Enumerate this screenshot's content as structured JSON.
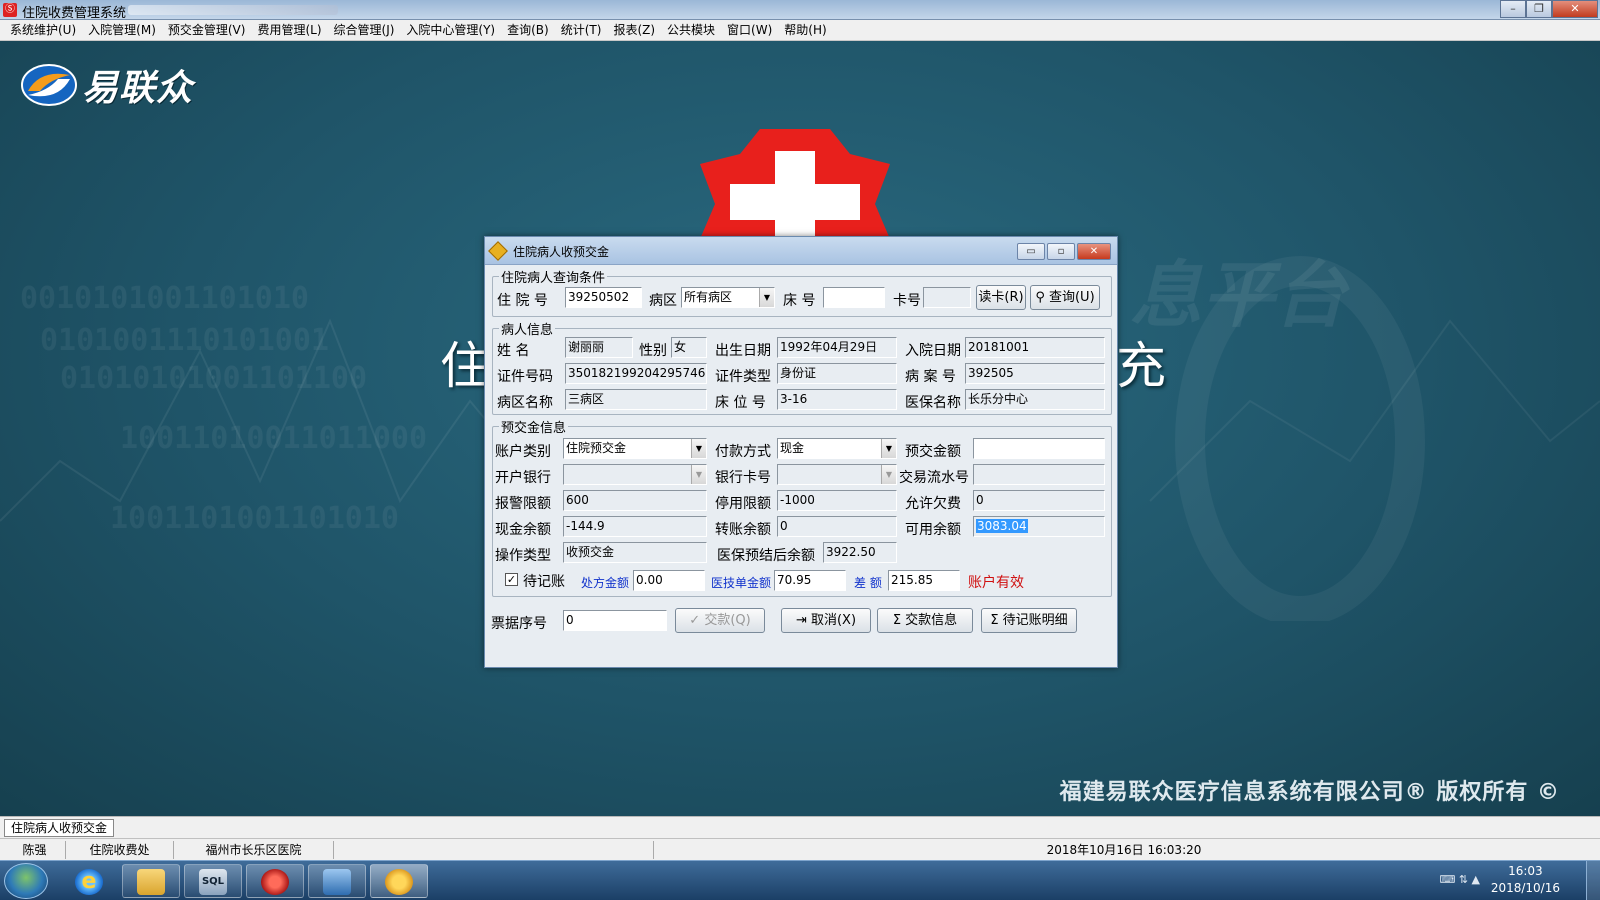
{
  "window": {
    "title": "住院收费管理系统"
  },
  "menubar": [
    "系统维护(U)",
    "入院管理(M)",
    "预交金管理(V)",
    "费用管理(L)",
    "综合管理(J)",
    "入院中心管理(Y)",
    "查询(B)",
    "统计(T)",
    "报表(Z)",
    "公共模块",
    "窗口(W)",
    "帮助(H)"
  ],
  "background": {
    "logo_text": "易联众",
    "title_left": "住",
    "title_right": "充",
    "slogan": "息平台",
    "copyright": "福建易联众医疗信息系统有限公司® 版权所有 ©",
    "digits": [
      "0010101001101010",
      "0101001110101001",
      "01010101001101100",
      "10011010011011000",
      "1001101001101010"
    ]
  },
  "dialog": {
    "title": "住院病人收预交金",
    "query": {
      "legend": "住院病人查询条件",
      "admission_no_label": "住 院 号",
      "admission_no": "39250502",
      "ward_label": "病区",
      "ward": "所有病区",
      "bed_label": "床 号",
      "bed": "",
      "card_label": "卡号",
      "card": "",
      "read_card_btn": "读卡(R)",
      "search_btn": "查询(U)"
    },
    "patient": {
      "legend": "病人信息",
      "name_label": "姓    名",
      "name": "谢丽丽",
      "gender_label": "性别",
      "gender": "女",
      "birth_label": "出生日期",
      "birth": "1992年04月29日",
      "admit_label": "入院日期",
      "admit": "20181001",
      "id_no_label": "证件号码",
      "id_no": "350182199204295746",
      "id_type_label": "证件类型",
      "id_type": "身份证",
      "case_no_label": "病 案 号",
      "case_no": "392505",
      "ward_name_label": "病区名称",
      "ward_name": "三病区",
      "bed_no_label": "床 位 号",
      "bed_no": "3-16",
      "insurance_label": "医保名称",
      "insurance": "长乐分中心"
    },
    "deposit": {
      "legend": "预交金信息",
      "account_type_label": "账户类别",
      "account_type": "住院预交金",
      "pay_method_label": "付款方式",
      "pay_method": "现金",
      "deposit_amount_label": "预交金额",
      "deposit_amount": "",
      "bank_label": "开户银行",
      "bank": "",
      "bank_card_label": "银行卡号",
      "bank_card": "",
      "txn_label": "交易流水号",
      "txn": "",
      "alert_limit_label": "报警限额",
      "alert_limit": "600",
      "stop_limit_label": "停用限额",
      "stop_limit": "-1000",
      "allow_arrears_label": "允许欠费",
      "allow_arrears": "0",
      "cash_balance_label": "现金余额",
      "cash_balance": "-144.9",
      "transfer_balance_label": "转账余额",
      "transfer_balance": "0",
      "available_label": "可用余额",
      "available": "3083.04",
      "op_type_label": "操作类型",
      "op_type": "收预交金",
      "ins_after_label": "医保预结后余额",
      "ins_after": "3922.50",
      "pending_label": "待记账",
      "rx_amount_label": "处方金额",
      "rx_amount": "0.00",
      "tech_amount_label": "医技单金额",
      "tech_amount": "70.95",
      "diff_label": "差  额",
      "diff": "215.85",
      "account_status": "账户有效"
    },
    "footer": {
      "receipt_label": "票据序号",
      "receipt": "0",
      "pay_btn": "交款(Q)",
      "cancel_btn": "取消(X)",
      "pay_info_btn": "交款信息",
      "pending_detail_btn": "待记账明细"
    }
  },
  "statusbar": {
    "active_tab": "住院病人收预交金",
    "user": "陈强",
    "dept": "住院收费处",
    "hospital": "福州市长乐区医院",
    "datetime": "2018年10月16日 16:03:20"
  },
  "taskbar": {
    "time": "16:03",
    "date": "2018/10/16"
  },
  "colors": {
    "workspace": "#1e5266",
    "cross": "#e8201c",
    "link_blue": "#1133cc",
    "status_red": "#d01010",
    "selection": "#3399ff"
  }
}
